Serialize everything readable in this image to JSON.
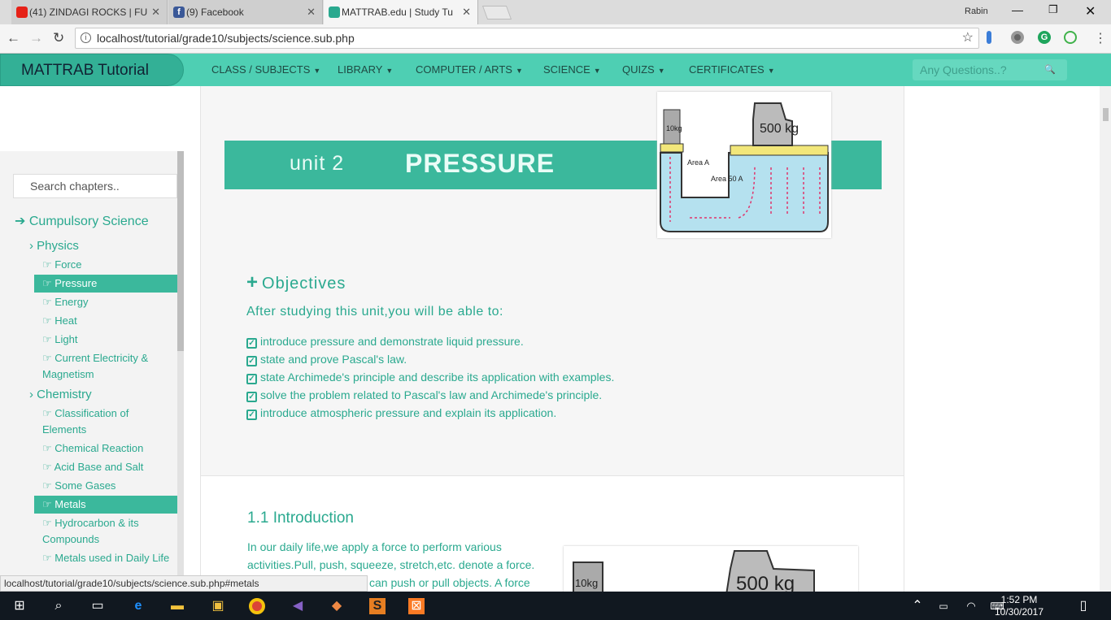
{
  "browser": {
    "tabs": [
      {
        "label": "(41) ZINDAGI ROCKS | FU",
        "favicon": "youtube-icon"
      },
      {
        "label": "(9) Facebook",
        "favicon": "facebook-icon"
      },
      {
        "label": "MATTRAB.edu | Study Tu",
        "favicon": "mattrab-icon"
      }
    ],
    "profile_name": "Rabin",
    "url": "localhost/tutorial/grade10/subjects/science.sub.php",
    "status_url": "localhost/tutorial/grade10/subjects/science.sub.php#metals"
  },
  "site": {
    "brand": "MATTRAB Tutorial",
    "nav": [
      "CLASS / SUBJECTS",
      "LIBRARY",
      "COMPUTER / ARTS",
      "SCIENCE",
      "QUIZS",
      "CERTIFICATES"
    ],
    "search_placeholder": "Any Questions..?",
    "accent": "#4ecfb3",
    "text_color": "#2aa98f"
  },
  "sidebar": {
    "search_placeholder": "Search chapters..",
    "root": "Cumpulsory Science",
    "physics": {
      "label": "Physics",
      "items": [
        "Force",
        "Pressure",
        "Energy",
        "Heat",
        "Light",
        "Current Electricity &",
        "Magnetism"
      ]
    },
    "chemistry": {
      "label": "Chemistry",
      "items": [
        "Classification of",
        "Elements",
        "Chemical Reaction",
        "Acid Base and Salt",
        "Some Gases",
        "Metals",
        "Hydrocarbon & its",
        "Compounds",
        "Metals used in Daily Life"
      ]
    }
  },
  "content": {
    "unit": "unit 2",
    "title": "PRESSURE",
    "illustration": {
      "weight_small": "10kg",
      "weight_large": "500 kg",
      "area_a": "Area A",
      "area_50a": "Area 50 A"
    },
    "objectives_heading": "Objectives",
    "objectives_intro": "After studying this unit,you will be able to:",
    "objectives": [
      "introduce pressure and demonstrate liquid pressure.",
      "state and prove Pascal's law.",
      "state Archimede's principle and describe its application with examples.",
      "solve the problem related to Pascal's law and Archimede's principle.",
      "introduce atmospheric pressure and explain its application."
    ],
    "intro_heading": "1.1 Introduction",
    "intro_lines": [
      "In our daily life,we apply a force to perform various",
      "activities.Pull, push, squeeze, stretch,etc. denote a force.",
      "can push or pull objects. A force"
    ]
  },
  "taskbar": {
    "time": "1:52 PM",
    "date": "10/30/2017"
  }
}
